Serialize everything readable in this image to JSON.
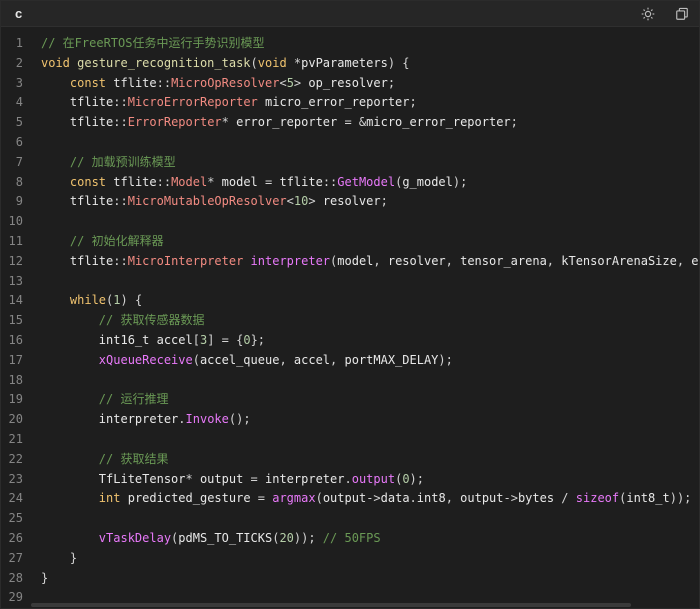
{
  "header": {
    "language": "c",
    "icons": [
      "theme-toggle-icon",
      "copy-icon"
    ]
  },
  "lines": [
    {
      "n": "1",
      "tokens": [
        [
          "c",
          "// 在FreeRTOS任务中运行手势识别模型"
        ]
      ]
    },
    {
      "n": "2",
      "tokens": [
        [
          "kw",
          "void"
        ],
        [
          "p",
          " "
        ],
        [
          "k",
          "gesture_recognition_task"
        ],
        [
          "p",
          "("
        ],
        [
          "kw",
          "void"
        ],
        [
          "p",
          " *"
        ],
        [
          "id",
          "pvParameters"
        ],
        [
          "p",
          ") {"
        ]
      ]
    },
    {
      "n": "3",
      "tokens": [
        [
          "p",
          "    "
        ],
        [
          "kw",
          "const"
        ],
        [
          "p",
          " "
        ],
        [
          "id",
          "tflite"
        ],
        [
          "p",
          "::"
        ],
        [
          "ty",
          "MicroOpResolver"
        ],
        [
          "p",
          "<"
        ],
        [
          "n",
          "5"
        ],
        [
          "p",
          "> "
        ],
        [
          "id",
          "op_resolver"
        ],
        [
          "p",
          ";"
        ]
      ]
    },
    {
      "n": "4",
      "tokens": [
        [
          "p",
          "    "
        ],
        [
          "id",
          "tflite"
        ],
        [
          "p",
          "::"
        ],
        [
          "ty",
          "MicroErrorReporter"
        ],
        [
          "p",
          " "
        ],
        [
          "id",
          "micro_error_reporter"
        ],
        [
          "p",
          ";"
        ]
      ]
    },
    {
      "n": "5",
      "tokens": [
        [
          "p",
          "    "
        ],
        [
          "id",
          "tflite"
        ],
        [
          "p",
          "::"
        ],
        [
          "ty",
          "ErrorReporter"
        ],
        [
          "p",
          "* "
        ],
        [
          "id",
          "error_reporter"
        ],
        [
          "p",
          " = &"
        ],
        [
          "id",
          "micro_error_reporter"
        ],
        [
          "p",
          ";"
        ]
      ]
    },
    {
      "n": "6",
      "tokens": []
    },
    {
      "n": "7",
      "tokens": [
        [
          "p",
          "    "
        ],
        [
          "c",
          "// 加载预训练模型"
        ]
      ]
    },
    {
      "n": "8",
      "tokens": [
        [
          "p",
          "    "
        ],
        [
          "kw",
          "const"
        ],
        [
          "p",
          " "
        ],
        [
          "id",
          "tflite"
        ],
        [
          "p",
          "::"
        ],
        [
          "ty",
          "Model"
        ],
        [
          "p",
          "* "
        ],
        [
          "id",
          "model"
        ],
        [
          "p",
          " = "
        ],
        [
          "id",
          "tflite"
        ],
        [
          "p",
          "::"
        ],
        [
          "fn",
          "GetModel"
        ],
        [
          "p",
          "("
        ],
        [
          "id",
          "g_model"
        ],
        [
          "p",
          ");"
        ]
      ]
    },
    {
      "n": "9",
      "tokens": [
        [
          "p",
          "    "
        ],
        [
          "id",
          "tflite"
        ],
        [
          "p",
          "::"
        ],
        [
          "ty",
          "MicroMutableOpResolver"
        ],
        [
          "p",
          "<"
        ],
        [
          "n",
          "10"
        ],
        [
          "p",
          "> "
        ],
        [
          "id",
          "resolver"
        ],
        [
          "p",
          ";"
        ]
      ]
    },
    {
      "n": "10",
      "tokens": []
    },
    {
      "n": "11",
      "tokens": [
        [
          "p",
          "    "
        ],
        [
          "c",
          "// 初始化解释器"
        ]
      ]
    },
    {
      "n": "12",
      "tokens": [
        [
          "p",
          "    "
        ],
        [
          "id",
          "tflite"
        ],
        [
          "p",
          "::"
        ],
        [
          "ty",
          "MicroInterpreter"
        ],
        [
          "p",
          " "
        ],
        [
          "fn",
          "interpreter"
        ],
        [
          "p",
          "("
        ],
        [
          "id",
          "model"
        ],
        [
          "p",
          ", "
        ],
        [
          "id",
          "resolver"
        ],
        [
          "p",
          ", "
        ],
        [
          "id",
          "tensor_arena"
        ],
        [
          "p",
          ", "
        ],
        [
          "id",
          "kTensorArenaSize"
        ],
        [
          "p",
          ", "
        ],
        [
          "id",
          "error"
        ]
      ]
    },
    {
      "n": "13",
      "tokens": []
    },
    {
      "n": "14",
      "tokens": [
        [
          "p",
          "    "
        ],
        [
          "kw",
          "while"
        ],
        [
          "p",
          "("
        ],
        [
          "n",
          "1"
        ],
        [
          "p",
          ") {"
        ]
      ]
    },
    {
      "n": "15",
      "tokens": [
        [
          "p",
          "        "
        ],
        [
          "c",
          "// 获取传感器数据"
        ]
      ]
    },
    {
      "n": "16",
      "tokens": [
        [
          "p",
          "        "
        ],
        [
          "id",
          "int16_t"
        ],
        [
          "p",
          " "
        ],
        [
          "id",
          "accel"
        ],
        [
          "p",
          "["
        ],
        [
          "n",
          "3"
        ],
        [
          "p",
          "] = {"
        ],
        [
          "n",
          "0"
        ],
        [
          "p",
          "};"
        ]
      ]
    },
    {
      "n": "17",
      "tokens": [
        [
          "p",
          "        "
        ],
        [
          "fn",
          "xQueueReceive"
        ],
        [
          "p",
          "("
        ],
        [
          "id",
          "accel_queue"
        ],
        [
          "p",
          ", "
        ],
        [
          "id",
          "accel"
        ],
        [
          "p",
          ", "
        ],
        [
          "id",
          "portMAX_DELAY"
        ],
        [
          "p",
          ");"
        ]
      ]
    },
    {
      "n": "18",
      "tokens": []
    },
    {
      "n": "19",
      "tokens": [
        [
          "p",
          "        "
        ],
        [
          "c",
          "// 运行推理"
        ]
      ]
    },
    {
      "n": "20",
      "tokens": [
        [
          "p",
          "        "
        ],
        [
          "id",
          "interpreter"
        ],
        [
          "p",
          "."
        ],
        [
          "fn",
          "Invoke"
        ],
        [
          "p",
          "();"
        ]
      ]
    },
    {
      "n": "21",
      "tokens": []
    },
    {
      "n": "22",
      "tokens": [
        [
          "p",
          "        "
        ],
        [
          "c",
          "// 获取结果"
        ]
      ]
    },
    {
      "n": "23",
      "tokens": [
        [
          "p",
          "        "
        ],
        [
          "id",
          "TfLiteTensor"
        ],
        [
          "p",
          "* "
        ],
        [
          "id",
          "output"
        ],
        [
          "p",
          " = "
        ],
        [
          "id",
          "interpreter"
        ],
        [
          "p",
          "."
        ],
        [
          "fn",
          "output"
        ],
        [
          "p",
          "("
        ],
        [
          "n",
          "0"
        ],
        [
          "p",
          ");"
        ]
      ]
    },
    {
      "n": "24",
      "tokens": [
        [
          "p",
          "        "
        ],
        [
          "kw",
          "int"
        ],
        [
          "p",
          " "
        ],
        [
          "id",
          "predicted_gesture"
        ],
        [
          "p",
          " = "
        ],
        [
          "fn",
          "argmax"
        ],
        [
          "p",
          "("
        ],
        [
          "id",
          "output"
        ],
        [
          "p",
          "->"
        ],
        [
          "id",
          "data"
        ],
        [
          "p",
          "."
        ],
        [
          "id",
          "int8"
        ],
        [
          "p",
          ", "
        ],
        [
          "id",
          "output"
        ],
        [
          "p",
          "->"
        ],
        [
          "id",
          "bytes"
        ],
        [
          "p",
          " / "
        ],
        [
          "fn",
          "sizeof"
        ],
        [
          "p",
          "("
        ],
        [
          "id",
          "int8_t"
        ],
        [
          "p",
          "));"
        ]
      ]
    },
    {
      "n": "25",
      "tokens": []
    },
    {
      "n": "26",
      "tokens": [
        [
          "p",
          "        "
        ],
        [
          "fn",
          "vTaskDelay"
        ],
        [
          "p",
          "("
        ],
        [
          "id",
          "pdMS_TO_TICKS"
        ],
        [
          "p",
          "("
        ],
        [
          "n",
          "20"
        ],
        [
          "p",
          ")); "
        ],
        [
          "c",
          "// 50FPS"
        ]
      ]
    },
    {
      "n": "27",
      "tokens": [
        [
          "p",
          "    }"
        ]
      ]
    },
    {
      "n": "28",
      "tokens": [
        [
          "p",
          "}"
        ]
      ]
    },
    {
      "n": "29",
      "tokens": []
    }
  ]
}
